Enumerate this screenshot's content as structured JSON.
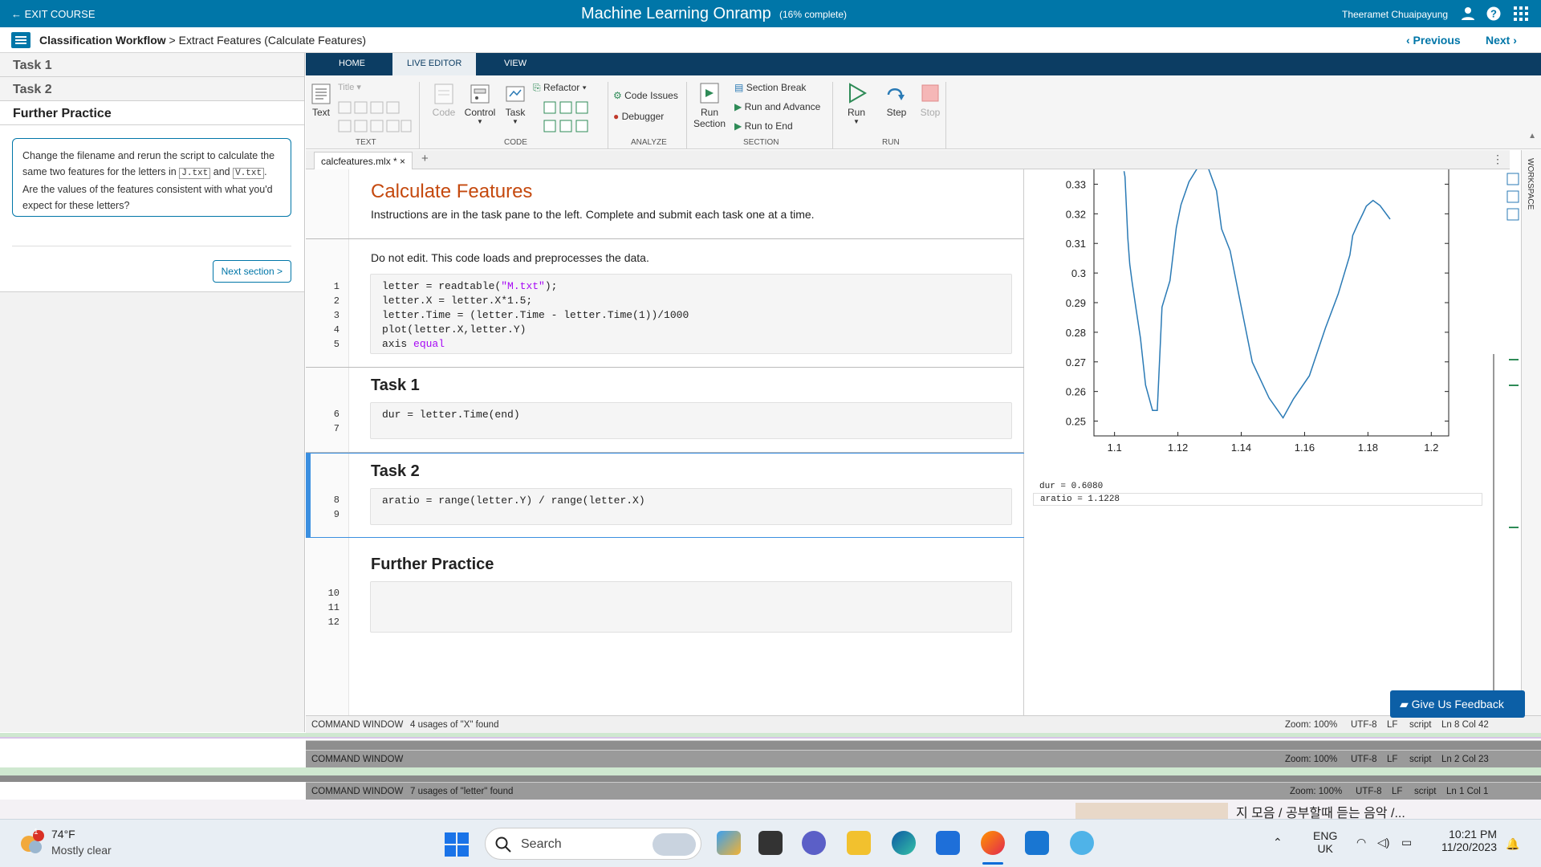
{
  "topbar": {
    "exit_label": "← EXIT COURSE",
    "title": "Machine Learning Onramp",
    "progress": "(16% complete)",
    "user": "Theeramet Chuaipayung",
    "icons": [
      "user-icon",
      "help-icon",
      "apps-grid-icon"
    ]
  },
  "breadcrumb": {
    "root": "Classification Workflow",
    "current": " > Extract Features (Calculate Features)",
    "previous": "‹ Previous",
    "next": "Next ›"
  },
  "taskpane": {
    "tabs": [
      "Task 1",
      "Task 2",
      "Further Practice"
    ],
    "instruction_pre": "Change the filename and rerun the script to calculate the same two features for the letters in",
    "file1": "J.txt",
    "and": "and",
    "file2": "V.txt",
    "instruction_post": ". Are the values of the features consistent with what you'd expect for these letters?",
    "next_section": "Next section >"
  },
  "ribbon": {
    "tabs": [
      "HOME",
      "LIVE EDITOR",
      "VIEW"
    ],
    "active_tab": "LIVE EDITOR",
    "text_group": {
      "text": "Text",
      "title": "Title",
      "label": "TEXT"
    },
    "code_group": {
      "code": "Code",
      "control": "Control",
      "task": "Task",
      "refactor": "Refactor",
      "label": "CODE"
    },
    "analyze_group": {
      "issues": "Code Issues",
      "debugger": "Debugger",
      "label": "ANALYZE"
    },
    "section_group": {
      "run_section": "Run Section",
      "section_break": "Section Break",
      "run_advance": "Run and Advance",
      "run_end": "Run to End",
      "label": "SECTION"
    },
    "run_group": {
      "run": "Run",
      "step": "Step",
      "stop": "Stop",
      "label": "RUN"
    }
  },
  "document": {
    "tab": "calcfeatures.mlx *",
    "close": "×",
    "add": "+",
    "title": "Calculate Features",
    "intro": "Instructions are in the task pane to the left. Complete and submit each task one at a time.",
    "preamble": "Do not edit. This code loads and preprocesses the data.",
    "code_lines": [
      "letter = readtable(",
      "letter.X = letter.X*1.5;",
      "letter.Time = (letter.Time - letter.Time(1))/1000",
      "plot(letter.X,letter.Y)",
      "axis "
    ],
    "string_literal": "\"M.txt\"",
    "string_tail": ");",
    "axis_arg": "equal",
    "task1_title": "Task 1",
    "task1_code": "dur = letter.Time(end)",
    "task2_title": "Task 2",
    "task2_code": "aratio = range(letter.Y) / range(letter.X)",
    "further_title": "Further Practice",
    "line_numbers": [
      "1",
      "2",
      "3",
      "4",
      "5",
      "6",
      "7",
      "8",
      "9",
      "10",
      "11",
      "12"
    ]
  },
  "output": {
    "dur": "dur = 0.6080",
    "aratio": "aratio = 1.1228"
  },
  "chart_data": {
    "type": "line",
    "x_ticks": [
      "1.1",
      "1.12",
      "1.14",
      "1.16",
      "1.18",
      "1.2"
    ],
    "y_ticks": [
      "0.33",
      "0.32",
      "0.31",
      "0.3",
      "0.29",
      "0.28",
      "0.27",
      "0.26",
      "0.25"
    ],
    "xlim": [
      1.0935,
      1.2055
    ],
    "ylim": [
      0.245,
      0.335
    ],
    "series": [
      {
        "x": [
          1.103,
          1.1033,
          1.1042,
          1.1048,
          1.1055,
          1.1068,
          1.1082,
          1.1098,
          1.112,
          1.1135,
          1.115,
          1.1175,
          1.1195,
          1.121,
          1.1235,
          1.1265,
          1.129,
          1.1322,
          1.1338,
          1.1365,
          1.1395,
          1.1435,
          1.1488,
          1.1532,
          1.1565,
          1.1615,
          1.1666,
          1.1706,
          1.1743,
          1.1752,
          1.1768,
          1.1784,
          1.1795,
          1.1816,
          1.1838,
          1.187
        ],
        "y": [
          0.3344,
          0.3325,
          0.3118,
          0.303,
          0.2972,
          0.2878,
          0.2779,
          0.2622,
          0.2536,
          0.2536,
          0.2885,
          0.2974,
          0.3153,
          0.3231,
          0.3308,
          0.336,
          0.3372,
          0.3278,
          0.3149,
          0.3075,
          0.2913,
          0.2699,
          0.2578,
          0.2511,
          0.2575,
          0.2653,
          0.2815,
          0.2929,
          0.3061,
          0.3127,
          0.3165,
          0.3201,
          0.3226,
          0.3245,
          0.3228,
          0.3182
        ]
      }
    ]
  },
  "statusbar": {
    "cmd_label": "COMMAND WINDOW",
    "usages": "4 usages of \"X\" found",
    "zoom": "Zoom: 100%",
    "enc": "UTF-8",
    "eol": "LF",
    "type": "script",
    "pos": "Ln 8  Col 42",
    "ghost1_pos": "Ln 2  Col 23",
    "ghost2_usages": "7 usages of \"letter\" found",
    "ghost2_pos": "Ln 1  Col 1"
  },
  "feedback": "Give Us Feedback",
  "taskbar": {
    "weather_temp": "74°F",
    "weather_desc": "Mostly clear",
    "weather_badge": "1",
    "search": "Search",
    "lang1": "ENG",
    "lang2": "UK",
    "time": "10:21 PM",
    "date": "11/20/2023",
    "media_title": "지 모음 / 공부할때 듣는 음악 /..."
  },
  "colors": {
    "brand": "#0076a8",
    "ribbon_dark": "#0c3d63",
    "heading_orange": "#c5490e",
    "plot_line": "#2a7ab5"
  }
}
